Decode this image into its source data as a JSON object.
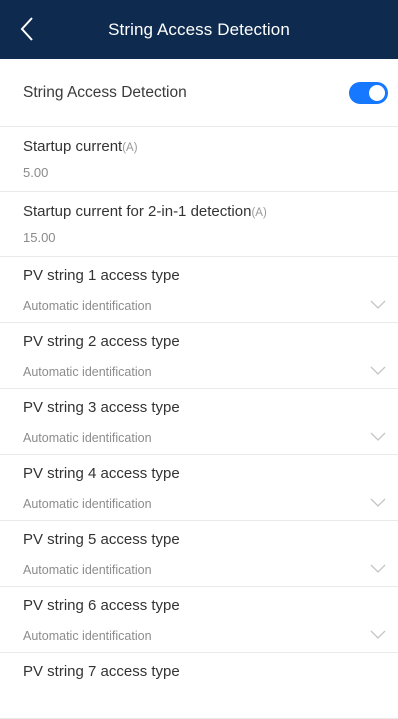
{
  "header": {
    "title": "String Access Detection",
    "back_icon": "chevron-left-icon"
  },
  "colors": {
    "header_bg": "#0e2a4e",
    "toggle_on": "#1677ff"
  },
  "toggle": {
    "label": "String Access Detection",
    "enabled": true
  },
  "fields": [
    {
      "title": "Startup current",
      "unit": "(A)",
      "value": "5.00"
    },
    {
      "title": "Startup current for 2-in-1 detection",
      "unit": "(A)",
      "value": "15.00"
    }
  ],
  "strings": [
    {
      "title": "PV string 1 access type",
      "value": "Automatic identification"
    },
    {
      "title": "PV string 2 access type",
      "value": "Automatic identification"
    },
    {
      "title": "PV string 3 access type",
      "value": "Automatic identification"
    },
    {
      "title": "PV string 4 access type",
      "value": "Automatic identification"
    },
    {
      "title": "PV string 5 access type",
      "value": "Automatic identification"
    },
    {
      "title": "PV string 6 access type",
      "value": "Automatic identification"
    },
    {
      "title": "PV string 7 access type",
      "value": ""
    }
  ]
}
